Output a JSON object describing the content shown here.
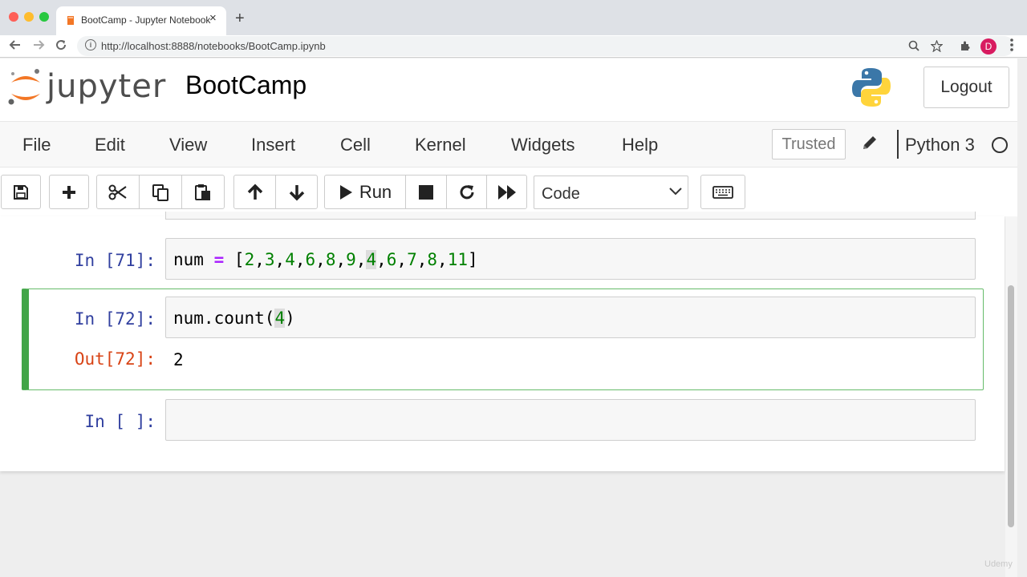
{
  "browser": {
    "tab_title": "BootCamp - Jupyter Notebook",
    "tab_close": "×",
    "new_tab": "+",
    "url": "http://localhost:8888/notebooks/BootCamp.ipynb",
    "avatar_letter": "D",
    "icons": [
      "back-arrow-icon",
      "forward-arrow-icon",
      "reload-icon",
      "info-icon",
      "zoom-icon",
      "star-icon",
      "extensions-icon",
      "more-icon"
    ]
  },
  "header": {
    "brand": "jupyter",
    "notebook_name": "BootCamp",
    "logout_label": "Logout"
  },
  "menubar": {
    "items": [
      "File",
      "Edit",
      "View",
      "Insert",
      "Cell",
      "Kernel",
      "Widgets",
      "Help"
    ],
    "trusted_label": "Trusted",
    "kernel_name": "Python 3"
  },
  "toolbar": {
    "run_label": "Run",
    "cell_type": "Code",
    "icons": [
      "save-icon",
      "plus-icon",
      "cut-icon",
      "copy-icon",
      "paste-icon",
      "arrow-up-icon",
      "arrow-down-icon",
      "play-icon",
      "stop-icon",
      "restart-icon",
      "fast-forward-icon",
      "keyboard-icon"
    ]
  },
  "cells": [
    {
      "prompt": "In [71]:",
      "code": "num = [2,3,4,6,8,9,4,6,7,8,11]",
      "tokens": {
        "name": "num",
        "op": "=",
        "lbr": "[",
        "rbr": "]",
        "comma": ",",
        "numbers": [
          "2",
          "3",
          "4",
          "6",
          "8",
          "9",
          "4",
          "6",
          "7",
          "8",
          "11"
        ]
      }
    },
    {
      "prompt": "In [72]:",
      "code": "num.count(4)",
      "tokens": {
        "callee": "num.count(",
        "arg": "4",
        "close": ")"
      },
      "output_prompt": "Out[72]:",
      "output": "2",
      "selected": true
    },
    {
      "prompt": "In [ ]:",
      "code": ""
    }
  ],
  "watermark": "Udemy",
  "colors": {
    "prompt_in": "#303f9f",
    "prompt_out": "#d84315",
    "selected_border": "#42a548",
    "number_token": "#008000",
    "operator_token": "#aa22ff",
    "jupyter_orange": "#f37726"
  }
}
